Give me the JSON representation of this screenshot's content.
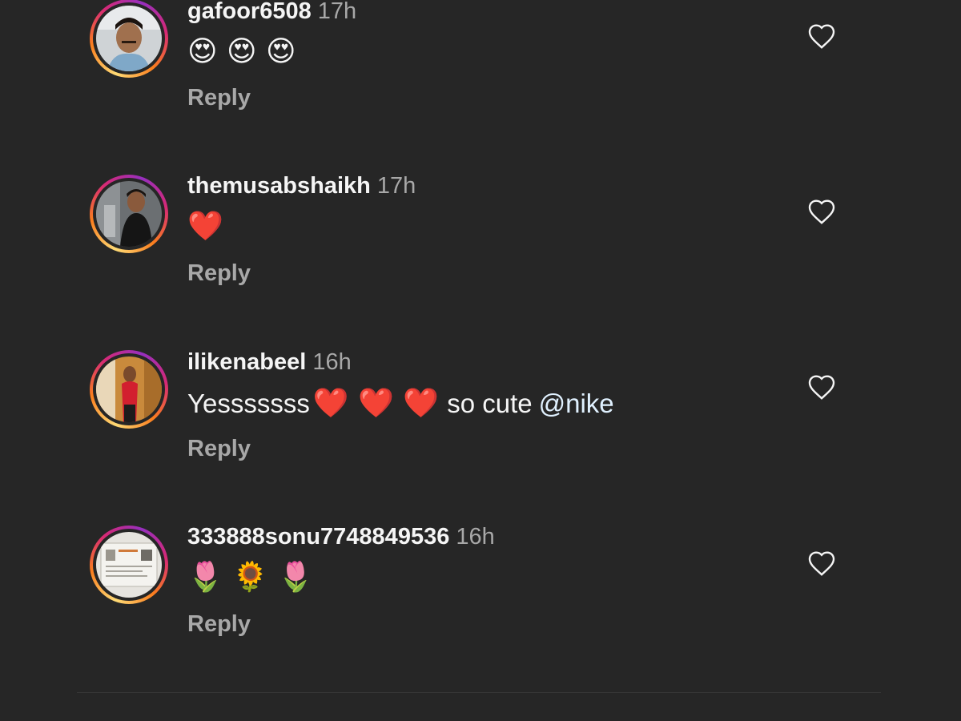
{
  "comments": [
    {
      "username": "gafoor6508",
      "time": "17h",
      "text": "😍 😍 😍",
      "reply_label": "Reply",
      "like_icon": "heart-outline-icon"
    },
    {
      "username": "themusabshaikh",
      "time": "17h",
      "text": "❤️",
      "reply_label": "Reply",
      "like_icon": "heart-outline-icon"
    },
    {
      "username": "ilikenabeel",
      "time": "16h",
      "text_prefix": "Yesssssss",
      "text_emojis": "❤️ ❤️ ❤️",
      "text_suffix": "so cute",
      "mention": "@nike",
      "reply_label": "Reply",
      "like_icon": "heart-outline-icon"
    },
    {
      "username": "333888sonu7748849536",
      "time": "16h",
      "text": "🌷 🌻 🌷",
      "reply_label": "Reply",
      "like_icon": "heart-outline-icon"
    }
  ],
  "colors": {
    "background": "#262626",
    "primary_text": "#f5f5f5",
    "secondary_text": "#a8a8a8",
    "mention": "#e0f1ff",
    "story_ring": [
      "#feda75",
      "#fa7e1e",
      "#d62976",
      "#962fbf"
    ]
  }
}
